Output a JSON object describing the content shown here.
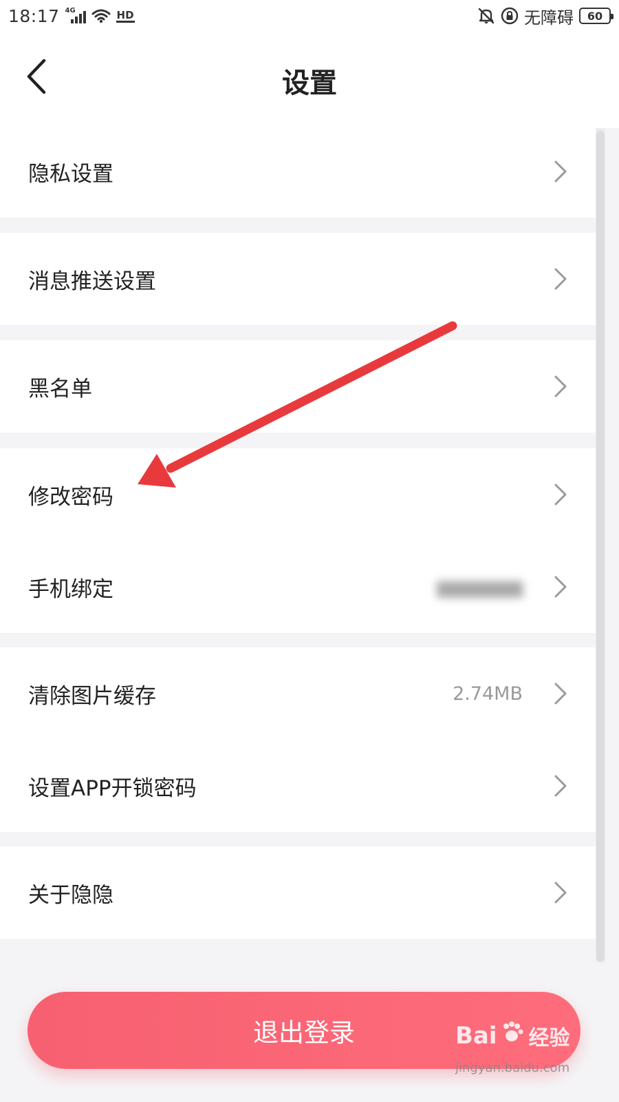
{
  "status_bar": {
    "time": "18:17",
    "network_tag": "4G",
    "hd_label": "HD",
    "accessibility_label": "无障碍",
    "battery_level": "60",
    "icons": [
      "signal-icon",
      "wifi-icon",
      "hd-icon",
      "bell-muted-icon",
      "lock-rotation-icon",
      "battery-icon"
    ]
  },
  "header": {
    "title": "设置",
    "back_icon": "chevron-left-icon"
  },
  "groups": [
    {
      "items": [
        {
          "label": "隐私设置"
        }
      ]
    },
    {
      "items": [
        {
          "label": "消息推送设置"
        }
      ]
    },
    {
      "items": [
        {
          "label": "黑名单"
        }
      ]
    },
    {
      "items": [
        {
          "label": "修改密码"
        },
        {
          "label": "手机绑定"
        }
      ]
    },
    {
      "items": [
        {
          "label": "清除图片缓存",
          "value": "2.74MB"
        },
        {
          "label": "设置APP开锁密码"
        }
      ]
    },
    {
      "items": [
        {
          "label": "关于隐隐"
        }
      ]
    }
  ],
  "logout": {
    "label": "退出登录"
  },
  "annotation": {
    "color": "#e83a3d",
    "points_to": "修改密码"
  },
  "watermark": {
    "brand": "Bai",
    "brand_suffix": "经验",
    "url": "jingyan.baidu.com"
  },
  "colors": {
    "accent": "#f76070",
    "background": "#f4f4f6",
    "row_text": "#222222",
    "secondary_text": "#999999",
    "chevron": "#9a9a9a"
  }
}
